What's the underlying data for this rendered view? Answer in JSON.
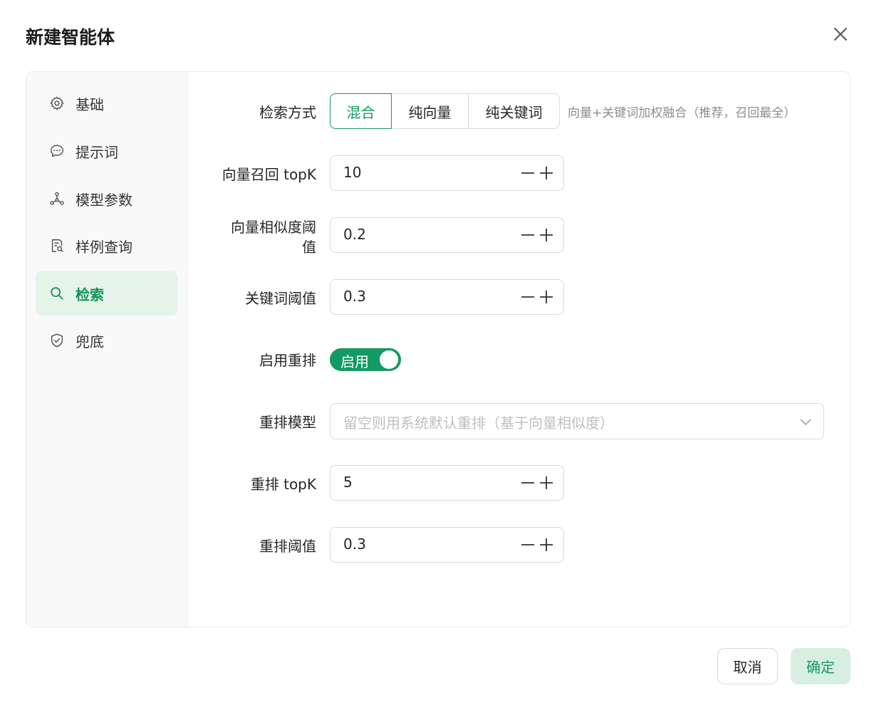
{
  "dialog": {
    "title": "新建智能体"
  },
  "sidebar": {
    "items": [
      {
        "label": "基础",
        "icon": "gear-icon"
      },
      {
        "label": "提示词",
        "icon": "chat-icon"
      },
      {
        "label": "模型参数",
        "icon": "network-icon"
      },
      {
        "label": "样例查询",
        "icon": "doc-search-icon"
      },
      {
        "label": "检索",
        "icon": "search-icon",
        "active": true
      },
      {
        "label": "兜底",
        "icon": "shield-check-icon"
      }
    ]
  },
  "form": {
    "retrieval_mode": {
      "label": "检索方式",
      "options": [
        "混合",
        "纯向量",
        "纯关键词"
      ],
      "selected": "混合",
      "hint": "向量+关键词加权融合（推荐，召回最全）"
    },
    "vector_topk": {
      "label": "向量召回 topK",
      "value": "10"
    },
    "vector_threshold": {
      "label_line1": "向量相似度阈",
      "label_line2": "值",
      "value": "0.2"
    },
    "keyword_threshold": {
      "label": "关键词阈值",
      "value": "0.3"
    },
    "rerank_enabled": {
      "label": "启用重排",
      "toggle_label": "启用",
      "on": true
    },
    "rerank_model": {
      "label": "重排模型",
      "placeholder": "留空则用系统默认重排（基于向量相似度）"
    },
    "rerank_topk": {
      "label": "重排 topK",
      "value": "5"
    },
    "rerank_threshold": {
      "label": "重排阈值",
      "value": "0.3"
    }
  },
  "footer": {
    "cancel_label": "取消",
    "confirm_label": "确定"
  },
  "colors": {
    "accent": "#139a63",
    "active_bg": "#e5f3e9",
    "confirm_bg": "#d7efe2"
  }
}
